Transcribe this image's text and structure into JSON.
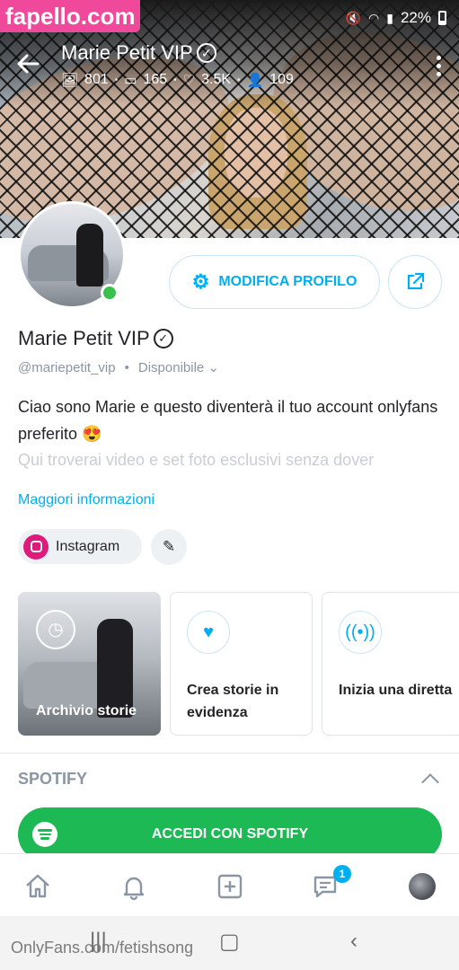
{
  "watermarks": {
    "top": "fapello.com",
    "bottom": "OnlyFans.com/fetishsong"
  },
  "statusbar": {
    "battery": "22%"
  },
  "header": {
    "title": "Marie Petit VIP",
    "stats": {
      "photos": "801",
      "videos": "165",
      "likes": "3.5K",
      "fans": "109"
    }
  },
  "buttons": {
    "edit_profile": "MODIFICA PROFILO"
  },
  "profile": {
    "name": "Marie Petit VIP",
    "handle": "@mariepetit_vip",
    "availability": "Disponibile",
    "bio_line1": "Ciao sono Marie e questo diventerà il tuo account onlyfans preferito 😍",
    "bio_line2": "Qui troverai video e set foto esclusivi senza dover",
    "more_info": "Maggiori informazioni",
    "instagram_label": "Instagram"
  },
  "stories": {
    "archive_label": "Archivio storie",
    "create_label": "Crea storie in evidenza",
    "live_label": "Inizia una diretta"
  },
  "spotify": {
    "section_title": "SPOTIFY",
    "button_label": "ACCEDI CON SPOTIFY"
  },
  "nav": {
    "messages_badge": "1"
  },
  "colors": {
    "accent": "#00aff0",
    "spotify": "#1db954",
    "watermark": "#f0499b",
    "online": "#3ac14b"
  }
}
